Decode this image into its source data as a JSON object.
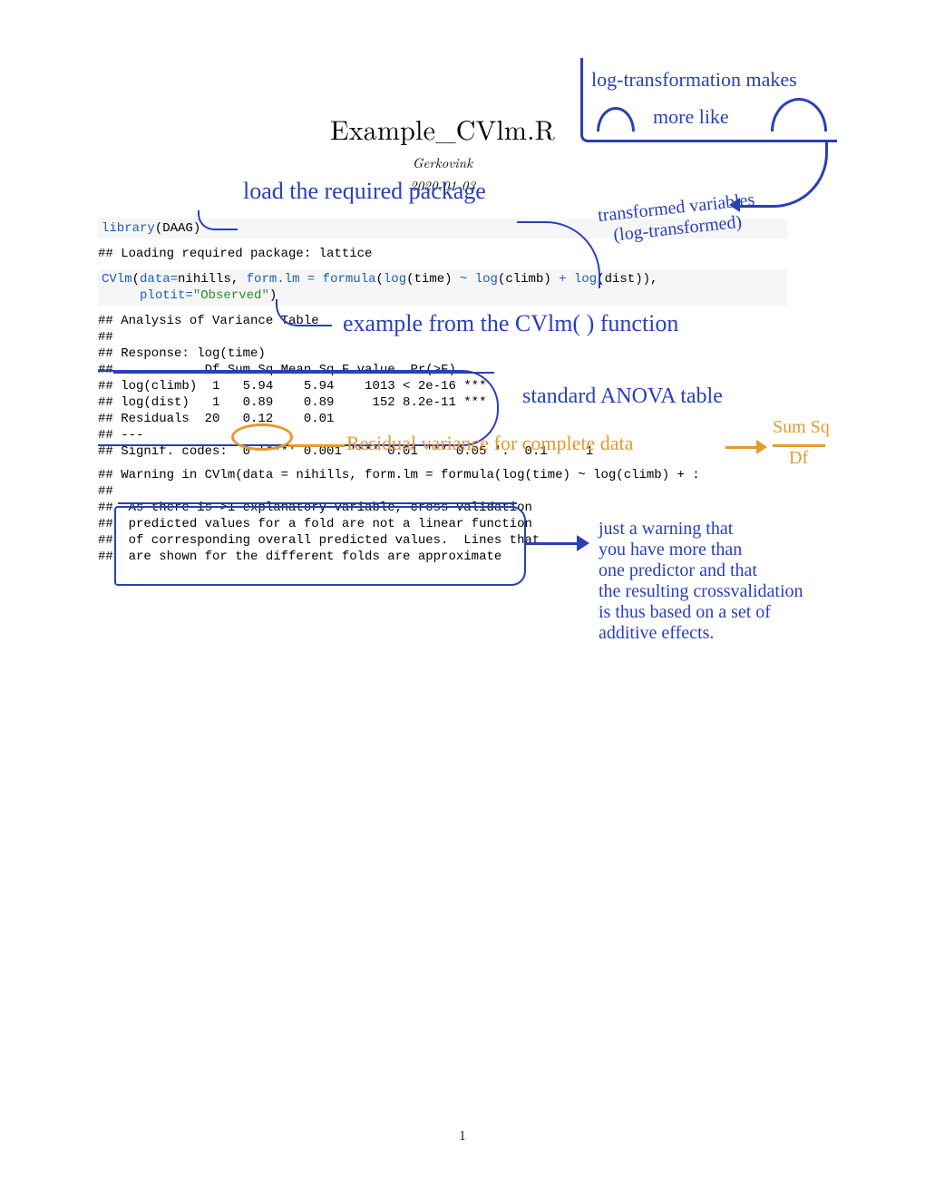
{
  "title": "Example_CVlm.R",
  "author": "Gerkovink",
  "date": "2020-01-03",
  "pagenum": "1",
  "code": {
    "library_kw": "library",
    "library_arg": "(DAAG)",
    "loading_msg": "## Loading required package: lattice",
    "cvlm_kw": "CVlm",
    "cvlm_open": "(",
    "cvlm_data_lbl": "data=",
    "cvlm_data_val": "nihills, ",
    "cvlm_form_lbl": "form.lm = ",
    "cvlm_formula_kw": "formula",
    "cvlm_formula_open": "(",
    "cvlm_log1": "log",
    "cvlm_time": "(time) ",
    "cvlm_tilde": "~ ",
    "cvlm_log2": "log",
    "cvlm_climb": "(climb) ",
    "cvlm_plus": "+ ",
    "cvlm_log3": "log",
    "cvlm_dist": "(dist)),",
    "cvlm_line2_indent": "     ",
    "cvlm_plotit_lbl": "plotit=",
    "cvlm_plotit_val": "\"Observed\"",
    "cvlm_close": ")"
  },
  "anova": {
    "l1": "## Analysis of Variance Table",
    "l2": "## ",
    "l3": "## Response: log(time)",
    "l4": "##            Df Sum Sq Mean Sq F value  Pr(>F)    ",
    "l5": "## log(climb)  1   5.94    5.94    1013 < 2e-16 ***",
    "l6": "## log(dist)   1   0.89    0.89     152 8.2e-11 ***",
    "l7": "## Residuals  20   0.12    0.01                    ",
    "l8": "## ---",
    "l9": "## Signif. codes:  0 '***' 0.001 '**' 0.01 '*' 0.05 '.' 0.1 ' ' 1"
  },
  "warning": {
    "l1": "## Warning in CVlm(data = nihills, form.lm = formula(log(time) ~ log(climb) + :",
    "l2": "## ",
    "l3": "##  As there is >1 explanatory variable, cross-validation",
    "l4": "##  predicted values for a fold are not a linear function",
    "l5": "##  of corresponding overall predicted values.  Lines that",
    "l6": "##  are shown for the different folds are approximate"
  },
  "annotations": {
    "log_transform": "log-transformation makes",
    "more_like": "more like",
    "load_pkg": "load the required package",
    "transformed": "transformed variables\n   (log-transformed)",
    "example_fn": "example from the CVlm( ) function",
    "std_anova": "standard ANOVA table",
    "resid_var": "Residual variance for complete data",
    "frac_top": "Sum Sq",
    "frac_bot": "Df",
    "warn_note": "just a warning that\nyou have more than\none predictor and that\nthe resulting crossvalidation\nis thus based on a set of\nadditive effects."
  }
}
